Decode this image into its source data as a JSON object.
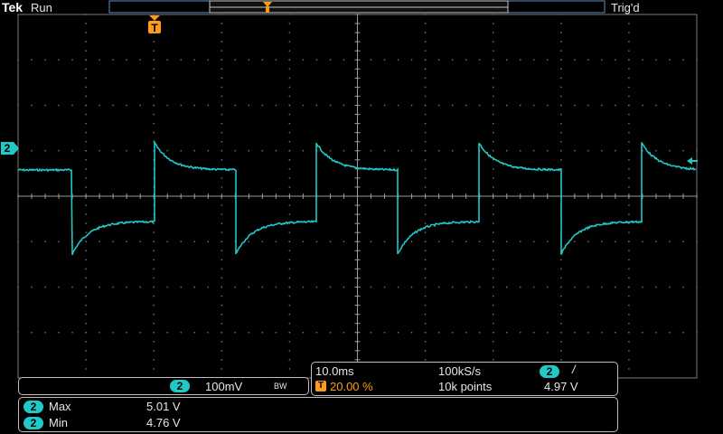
{
  "status_bar": {
    "brand": "Tek",
    "acq_state": "Run",
    "trigger_state": "Trig'd",
    "trigger_marker": "T"
  },
  "channel": {
    "number": "2",
    "volts_per_div": "100mV",
    "bandwidth_flag": "BW"
  },
  "timebase": {
    "time_per_div": "10.0ms",
    "trigger_position": "20.00 %",
    "sample_rate": "100kS/s",
    "record_length": "10k points",
    "trigger_source": "2",
    "trigger_slope": "/",
    "trigger_level": "4.97 V",
    "trigger_icon": "T"
  },
  "measurements": [
    {
      "source": "2",
      "name": "Max",
      "value": "5.01 V"
    },
    {
      "source": "2",
      "name": "Min",
      "value": "4.76 V"
    }
  ],
  "colors": {
    "trace": "#21c8c8",
    "trigger": "#ff9a1a",
    "graticule": "#7a7a7a",
    "background": "#000000"
  },
  "icons": {
    "trigger_marker": "trigger-t-icon",
    "trigger_level": "trigger-level-arrow-icon",
    "channel_ground": "channel-2-ground-marker-icon"
  }
}
